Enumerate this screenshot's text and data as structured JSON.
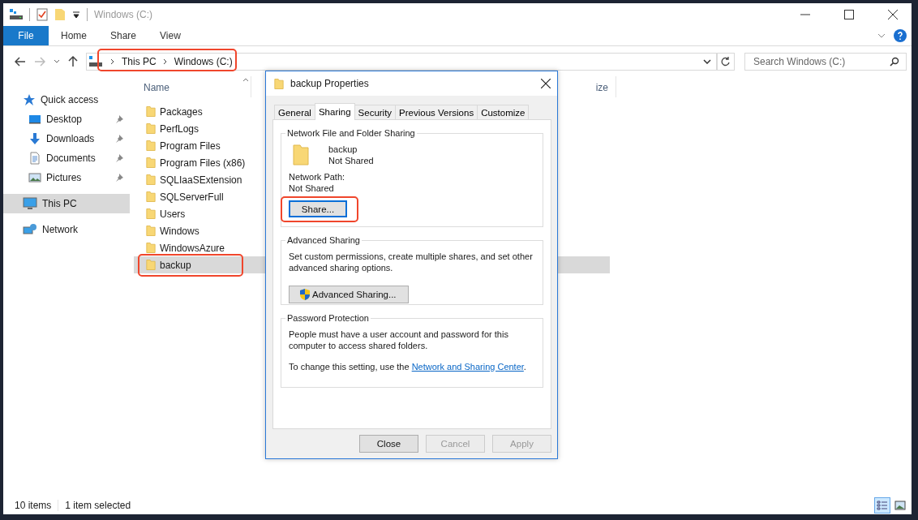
{
  "window": {
    "title": "Windows (C:)"
  },
  "ribbon": {
    "file_tab": "File",
    "tabs": [
      "Home",
      "Share",
      "View"
    ]
  },
  "address_bar": {
    "path": [
      "This PC",
      "Windows (C:)"
    ],
    "highlighted": true
  },
  "search": {
    "placeholder": "Search Windows (C:)"
  },
  "navigation": [
    {
      "label": "Quick access",
      "kind": "star",
      "selected": false,
      "children": [
        {
          "label": "Desktop",
          "kind": "desktop",
          "selected": false,
          "pinned": true
        },
        {
          "label": "Downloads",
          "kind": "download",
          "selected": false,
          "pinned": true
        },
        {
          "label": "Documents",
          "kind": "document",
          "selected": false,
          "pinned": true
        },
        {
          "label": "Pictures",
          "kind": "picture",
          "selected": false,
          "pinned": true
        }
      ]
    },
    {
      "label": "This PC",
      "kind": "computer",
      "selected": true
    },
    {
      "label": "Network",
      "kind": "network",
      "selected": false
    }
  ],
  "file_list": {
    "columns": [
      "Name",
      "ize"
    ],
    "items": [
      {
        "name": "Packages",
        "selected": false,
        "highlighted": false
      },
      {
        "name": "PerfLogs",
        "selected": false,
        "highlighted": false
      },
      {
        "name": "Program Files",
        "selected": false,
        "highlighted": false
      },
      {
        "name": "Program Files (x86)",
        "selected": false,
        "highlighted": false
      },
      {
        "name": "SQLIaaSExtension",
        "selected": false,
        "highlighted": false
      },
      {
        "name": "SQLServerFull",
        "selected": false,
        "highlighted": false
      },
      {
        "name": "Users",
        "selected": false,
        "highlighted": false
      },
      {
        "name": "Windows",
        "selected": false,
        "highlighted": false
      },
      {
        "name": "WindowsAzure",
        "selected": false,
        "highlighted": false
      },
      {
        "name": "backup",
        "selected": true,
        "highlighted": true
      }
    ]
  },
  "dialog": {
    "title": "backup Properties",
    "tabs": [
      {
        "label": "General",
        "selected": false
      },
      {
        "label": "Sharing",
        "selected": true
      },
      {
        "label": "Security",
        "selected": false
      },
      {
        "label": "Previous Versions",
        "selected": false
      },
      {
        "label": "Customize",
        "selected": false
      }
    ],
    "network_sharing": {
      "heading": "Network File and Folder Sharing",
      "folder_name": "backup",
      "folder_status": "Not Shared",
      "path_label": "Network Path:",
      "path_value": "Not Shared",
      "button": "Share...",
      "highlighted": true
    },
    "advanced_sharing": {
      "heading": "Advanced Sharing",
      "description": "Set custom permissions, create multiple shares, and set other advanced sharing options.",
      "button": "Advanced Sharing..."
    },
    "password_protection": {
      "heading": "Password Protection",
      "description": "People must have a user account and password for this computer to access shared folders.",
      "note": "To change this setting, use the",
      "link": "Network and Sharing Center",
      "note_end": "."
    },
    "buttons": [
      {
        "label": "Close",
        "disabled": false
      },
      {
        "label": "Cancel",
        "disabled": true
      },
      {
        "label": "Apply",
        "disabled": true
      }
    ]
  },
  "status_bar": {
    "item_count": "10 items",
    "selection": "1 item selected",
    "views": [
      {
        "kind": "details",
        "selected": true
      },
      {
        "kind": "thumbnails",
        "selected": false
      }
    ]
  }
}
